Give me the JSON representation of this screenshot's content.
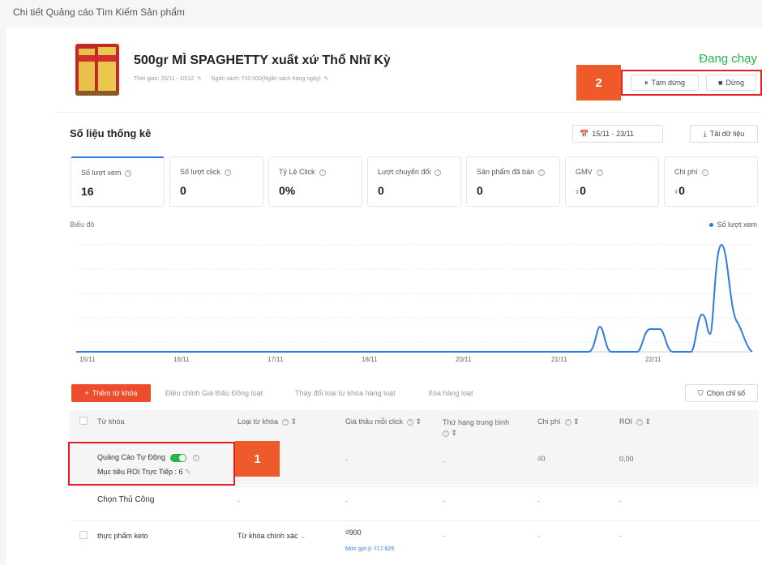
{
  "breadcrumb": "Chi tiết Quảng cáo Tìm Kiếm Sản phẩm",
  "product": {
    "title": "500gr MÌ SPAGHETTY xuất xứ Thổ Nhĩ Kỳ",
    "time_label": "Thời gian: 20/11 - 10/12",
    "budget_label": "Ngân sách: ₫10.000(Ngân sách hàng ngày)",
    "status": "Đang chạy"
  },
  "actions": {
    "pause": "Tạm dừng",
    "stop": "Dừng"
  },
  "stats": {
    "title": "Số liệu thống kê",
    "date_range": "15/11 - 23/11",
    "download": "Tải dữ liệu",
    "metrics": [
      {
        "label": "Số lượt xem",
        "value": "16",
        "currency": ""
      },
      {
        "label": "Số lượt click",
        "value": "0",
        "currency": ""
      },
      {
        "label": "Tỷ Lệ Click",
        "value": "0%",
        "currency": ""
      },
      {
        "label": "Lượt chuyển đổi",
        "value": "0",
        "currency": ""
      },
      {
        "label": "Sản phẩm đã bán",
        "value": "0",
        "currency": ""
      },
      {
        "label": "GMV",
        "value": "0",
        "currency": "₫"
      },
      {
        "label": "Chi phí",
        "value": "0",
        "currency": "₫"
      }
    ]
  },
  "chart_data": {
    "type": "line",
    "title": "Biểu đồ",
    "categories": [
      "15/11",
      "16/11",
      "17/11",
      "18/11",
      "20/11",
      "21/11",
      "22/11"
    ],
    "series": [
      {
        "name": "Số lượt xem",
        "color": "#2d7be5"
      }
    ],
    "peaks_note": ""
  },
  "toolbar": {
    "add": "Thêm từ khóa",
    "bid_adjust": "Điều chỉnh Giá thầu Đồng loạt",
    "match_change": "Thay đổi loại từ khóa hàng loạt",
    "bulk_delete": "Xóa hàng loạt",
    "choose_metrics": "Chọn chỉ số"
  },
  "table": {
    "headers": {
      "keyword": "Từ khóa",
      "match_type": "Loại từ khóa",
      "bid": "Giá thầu mỗi click",
      "rank": "Thứ hạng trung bình",
      "cost": "Chi phí",
      "roi": "ROI"
    },
    "auto": {
      "label": "Quảng Cáo Tự Động",
      "target": "Mục tiêu ROI Trực Tiếp : 6",
      "match": "-",
      "bid": "-",
      "rank": "-",
      "cost": "₫0",
      "roi": "0,00"
    },
    "manual": {
      "label": "Chọn Thủ Công",
      "match": "-",
      "bid": "-",
      "rank": "-",
      "cost": "-",
      "roi": "-"
    },
    "keyword_row": {
      "keyword": "thực phẩm keto",
      "match": "Từ khóa chính xác",
      "bid": "₫900",
      "suggest": "Mức gợi ý: ₫17.625",
      "rank": "-",
      "cost": "-",
      "roi": "-"
    }
  },
  "callouts": {
    "one": "1",
    "two": "2"
  }
}
